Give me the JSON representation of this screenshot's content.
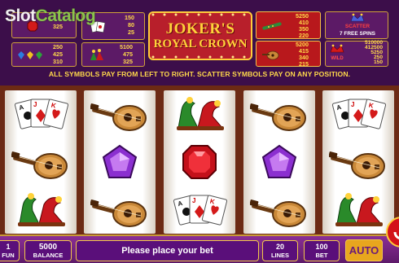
{
  "watermark": {
    "slot": "Slot",
    "catalog": "Catalog"
  },
  "logo": {
    "line1": "JOKER'S",
    "line2": "ROYAL CROWN"
  },
  "paytable": {
    "rows": [
      {
        "symbol": "red-gem-icon",
        "pays": [
          "325"
        ]
      },
      {
        "symbol": "playing-cards-icon",
        "pays": [
          "150",
          "80",
          "25"
        ]
      },
      {
        "symbol": "three-gems-icon",
        "pays": [
          "250",
          "425",
          "310"
        ]
      },
      {
        "symbol": "jester-shoes-icon",
        "pays": [
          "5100",
          "475",
          "325"
        ]
      },
      {
        "symbol": "flute-icon",
        "pays": [
          "5250",
          "410",
          "350",
          "220"
        ]
      },
      {
        "symbol": "lute-icon",
        "pays": [
          "5200",
          "415",
          "340",
          "215"
        ]
      },
      {
        "symbol": "wild-joker-icon",
        "label": "WILD",
        "pays": [
          "510000",
          "412500",
          "5250",
          "250",
          "150"
        ]
      }
    ],
    "scatter": {
      "symbol": "scatter-joker-icon",
      "label": "SCATTER",
      "note": "7 FREE SPINS"
    },
    "rule": "ALL SYMBOLS PAY FROM LEFT TO RIGHT. SCATTER SYMBOLS PAY ON ANY POSITION."
  },
  "reels": [
    [
      "playing-cards-icon",
      "lute-icon",
      "jester-shoes-icon"
    ],
    [
      "lute-icon",
      "purple-gem-icon",
      "lute-icon"
    ],
    [
      "jester-shoes-icon",
      "red-gem-icon",
      "playing-cards-icon"
    ],
    [
      "lute-icon",
      "purple-gem-icon",
      "lute-icon"
    ],
    [
      "playing-cards-icon",
      "lute-icon",
      "jester-shoes-icon"
    ]
  ],
  "bar": {
    "fun_value": "1",
    "fun_label": "FUN",
    "balance_value": "5000",
    "balance_label": "BALANCE",
    "message": "Please place your bet",
    "lines_value": "20",
    "lines_label": "LINES",
    "bet_value": "100",
    "bet_label": "BET",
    "auto_label": "AUTO"
  },
  "colors": {
    "accent": "#ffd23a",
    "panel": "#5a0f7a",
    "spin": "#d3121a"
  }
}
